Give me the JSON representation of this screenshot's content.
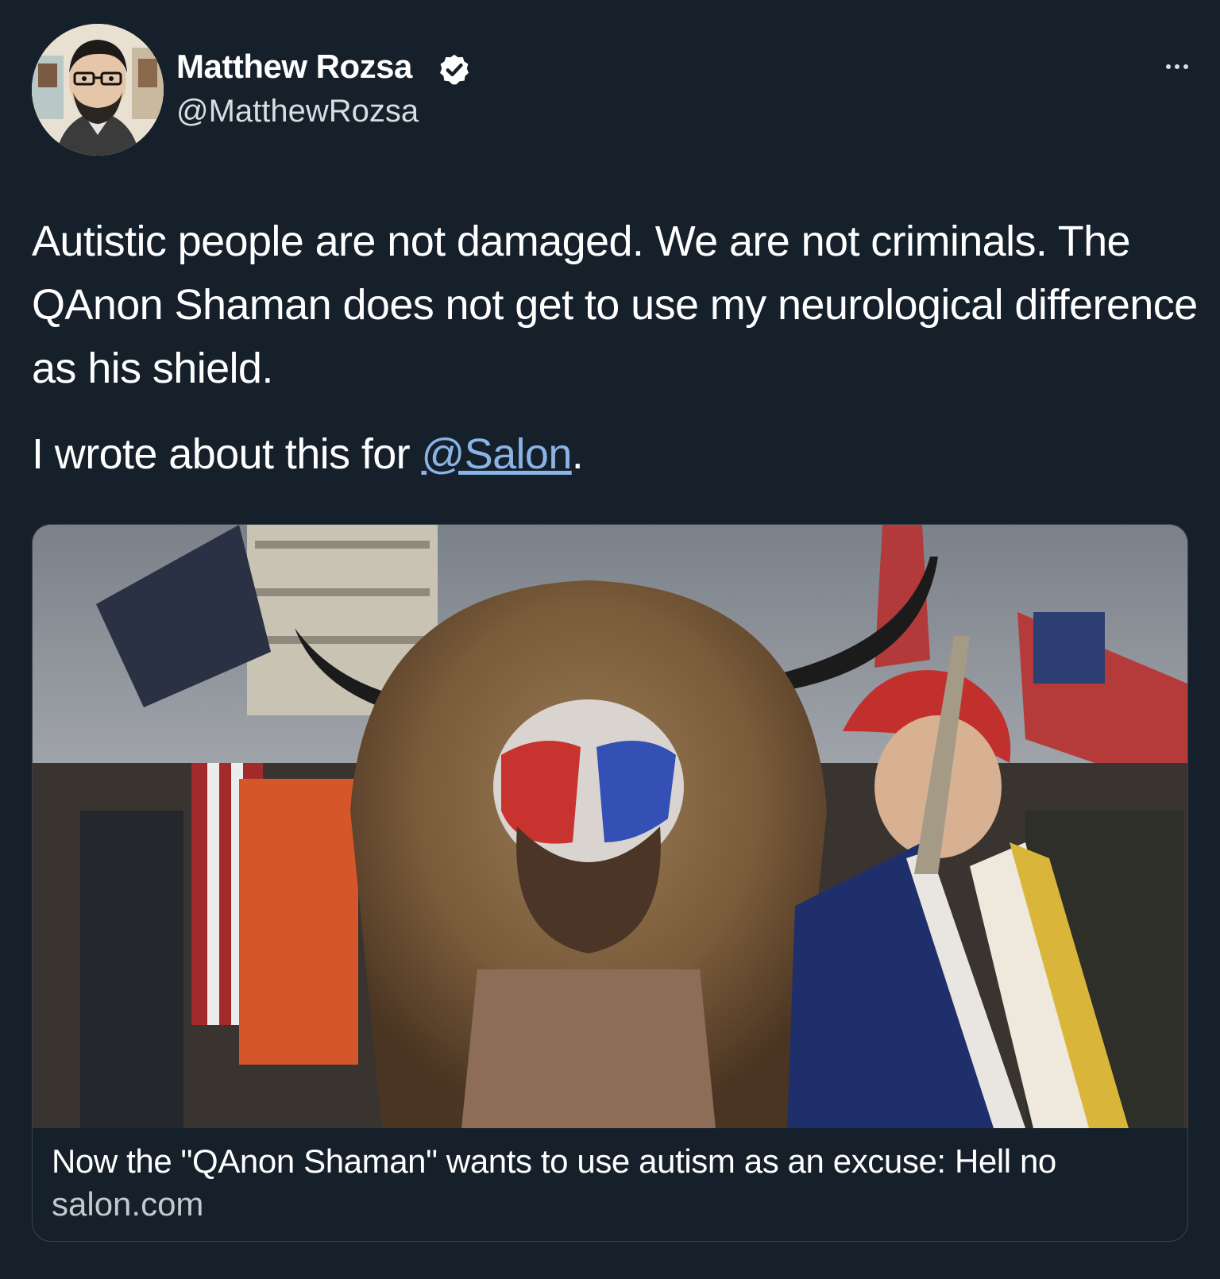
{
  "author": {
    "name": "Matthew Rozsa",
    "handle": "@MatthewRozsa",
    "verified_icon": "verified-badge-icon",
    "avatar_icon": "avatar-illustration"
  },
  "tweet": {
    "paragraph1": "Autistic people are not damaged. We are not criminals. The QAnon Shaman does not get to use my neurological difference as his shield.",
    "paragraph2_prefix": "I wrote about this for ",
    "mention": "@Salon",
    "paragraph2_suffix": "."
  },
  "card": {
    "title": "Now the \"QAnon Shaman\" wants to use autism as an excuse: Hell no",
    "domain": "salon.com",
    "image_icon": "article-photo"
  },
  "colors": {
    "background": "#15202b",
    "link": "#8ab4e6",
    "secondary_text": "#d8dde1"
  }
}
